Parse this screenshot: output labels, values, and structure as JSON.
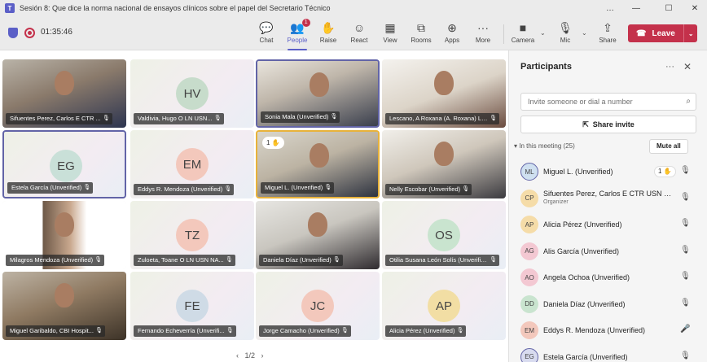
{
  "window": {
    "title": "Sesión 8: Que dice la norma nacional de ensayos clínicos sobre el papel del Secretario Técnico",
    "controls": [
      "…",
      "—",
      "☐",
      "✕"
    ]
  },
  "toolbar": {
    "timer": "01:35:46",
    "buttons": [
      {
        "label": "Chat",
        "icon": "chat-icon"
      },
      {
        "label": "People",
        "icon": "people-icon",
        "badge": "1"
      },
      {
        "label": "Raise",
        "icon": "hand-icon"
      },
      {
        "label": "React",
        "icon": "smiley-icon"
      },
      {
        "label": "View",
        "icon": "grid-icon"
      },
      {
        "label": "Rooms",
        "icon": "rooms-icon"
      },
      {
        "label": "Apps",
        "icon": "apps-icon"
      },
      {
        "label": "More",
        "icon": "more-icon"
      },
      {
        "label": "Camera",
        "icon": "camera-icon"
      },
      {
        "label": "Mic",
        "icon": "mic-off-icon"
      },
      {
        "label": "Share",
        "icon": "share-icon"
      }
    ],
    "leave_label": "Leave"
  },
  "grid": {
    "tiles": [
      {
        "name": "Sifuentes Perez, Carlos E CTR ...",
        "kind": "video"
      },
      {
        "name": "Valdivia, Hugo O LN USN...",
        "initials": "HV",
        "color": "#c7dccb",
        "kind": "avatar"
      },
      {
        "name": "Sonia Mala (Unverified)",
        "kind": "video"
      },
      {
        "name": "Lescano, A Roxana (A. Roxana) LN...",
        "kind": "video"
      },
      {
        "name": "Estela García (Unverified)",
        "initials": "EG",
        "color": "#c9e0d8",
        "kind": "avatar"
      },
      {
        "name": "Eddys R. Mendoza (Unverified)",
        "initials": "EM",
        "color": "#f3c8bc",
        "kind": "avatar"
      },
      {
        "name": "Miguel L. (Unverified)",
        "kind": "video",
        "hand": "1"
      },
      {
        "name": "Nelly Escobar (Unverified)",
        "kind": "video"
      },
      {
        "name": "Milagros Mendoza (Unverified)",
        "kind": "video"
      },
      {
        "name": "Zuloeta, Toane O LN USN NA...",
        "initials": "TZ",
        "color": "#f3c8bc",
        "kind": "avatar"
      },
      {
        "name": "Daniela Díaz (Unverified)",
        "kind": "video"
      },
      {
        "name": "Otilia Susana León Solís (Unverifie...",
        "initials": "OS",
        "color": "#c9e4cf",
        "kind": "avatar"
      },
      {
        "name": "Miguel Garibaldo, CBI Hospit...",
        "kind": "video"
      },
      {
        "name": "Fernando Echeverría (Unverifi...",
        "initials": "FE",
        "color": "#cfdbe6",
        "kind": "avatar"
      },
      {
        "name": "Jorge Camacho (Unverified)",
        "initials": "JC",
        "color": "#f3c8bc",
        "kind": "avatar"
      },
      {
        "name": "Alicia Pérez (Unverified)",
        "initials": "AP",
        "color": "#f2dea4",
        "kind": "avatar"
      }
    ],
    "pager": "1/2"
  },
  "panel": {
    "title": "Participants",
    "invite_placeholder": "Invite someone or dial a number",
    "share_label": "Share invite",
    "section_label": "In this meeting (25)",
    "mute_all": "Mute all",
    "people": [
      {
        "name": "Miguel L. (Unverified)",
        "initials": "ML",
        "color": "#cfe0f0",
        "hand": "1"
      },
      {
        "name": "Sifuentes Perez, Carlos E CTR USN N...",
        "initials": "CP",
        "color": "#f5dca8",
        "role": "Organizer"
      },
      {
        "name": "Alicia Pérez (Unverified)",
        "initials": "AP",
        "color": "#f5dca8"
      },
      {
        "name": "Alis García (Unverified)",
        "initials": "AG",
        "color": "#f3c8d2"
      },
      {
        "name": "Angela Ochoa (Unverified)",
        "initials": "AO",
        "color": "#f3c8d2"
      },
      {
        "name": "Daniela Díaz (Unverified)",
        "initials": "DD",
        "color": "#c9e4cf"
      },
      {
        "name": "Eddys R. Mendoza (Unverified)",
        "initials": "EM",
        "color": "#f3c8bc"
      },
      {
        "name": "Estela García (Unverified)",
        "initials": "EG",
        "color": "#d8dbef"
      }
    ]
  }
}
